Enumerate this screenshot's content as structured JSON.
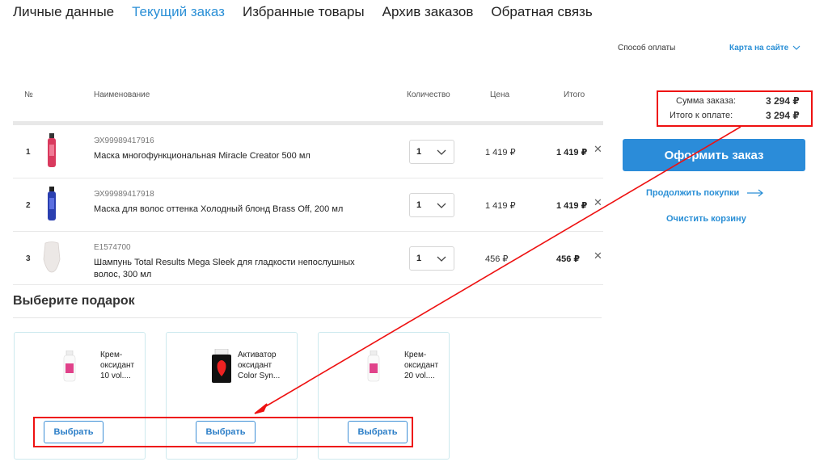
{
  "tabs": [
    {
      "label": "Личные данные"
    },
    {
      "label": "Текущий заказ"
    },
    {
      "label": "Избранные товары"
    },
    {
      "label": "Архив заказов"
    },
    {
      "label": "Обратная связь"
    }
  ],
  "table": {
    "headers": {
      "num": "№",
      "name": "Наименование",
      "qty": "Количество",
      "price": "Цена",
      "total": "Итого"
    },
    "rows": [
      {
        "num": "1",
        "sku": "ЭХ99989417916",
        "name": "Маска многофункциональная Miracle Creator 500 мл",
        "qty": "1",
        "price": "1 419 ₽",
        "total": "1 419 ₽",
        "color": "#d93a5e"
      },
      {
        "num": "2",
        "sku": "ЭХ99989417918",
        "name": "Маска для волос оттенка Холодный блонд Brass Off, 200 мл",
        "qty": "1",
        "price": "1 419 ₽",
        "total": "1 419 ₽",
        "color": "#2a3fb0"
      },
      {
        "num": "3",
        "sku": "E1574700",
        "name": "Шампунь Total Results Mega Sleek для гладкости непослушных волос, 300 мл",
        "qty": "1",
        "price": "456 ₽",
        "total": "456 ₽",
        "color": "#e8e3e0"
      }
    ]
  },
  "gifts": {
    "title": "Выберите подарок",
    "items": [
      {
        "name": "Крем-оксидант 10 vol....",
        "button": "Выбрать"
      },
      {
        "name": "Активатор оксидант Color Syn...",
        "button": "Выбрать"
      },
      {
        "name": "Крем-оксидант 20 vol....",
        "button": "Выбрать"
      }
    ]
  },
  "sidebar": {
    "payment_label": "Способ оплаты",
    "payment_value": "Карта на сайте",
    "order_sum_label": "Сумма заказа:",
    "order_sum_value": "3 294 ₽",
    "to_pay_label": "Итого к оплате:",
    "to_pay_value": "3 294 ₽",
    "checkout_button": "Оформить заказ",
    "continue_link": "Продолжить покупки",
    "clear_link": "Очистить корзину"
  },
  "colors": {
    "accent": "#2a8fd6",
    "button": "#2b8cd9",
    "annotation": "#ee1111"
  }
}
